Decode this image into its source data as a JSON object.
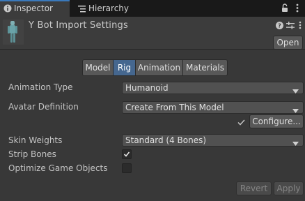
{
  "tabs": {
    "inspector": "Inspector",
    "hierarchy": "Hierarchy"
  },
  "header": {
    "title": "Y Bot Import Settings",
    "open_label": "Open"
  },
  "segments": [
    "Model",
    "Rig",
    "Animation",
    "Materials"
  ],
  "active_segment": "Rig",
  "fields": {
    "animation_type": {
      "label": "Animation Type",
      "value": "Humanoid"
    },
    "avatar_definition": {
      "label": "Avatar Definition",
      "value": "Create From This Model"
    },
    "configure_label": "Configure...",
    "skin_weights": {
      "label": "Skin Weights",
      "value": "Standard (4 Bones)"
    },
    "strip_bones": {
      "label": "Strip Bones",
      "checked": true
    },
    "optimize_game_objects": {
      "label": "Optimize Game Objects",
      "checked": false
    }
  },
  "footer": {
    "revert_label": "Revert",
    "apply_label": "Apply"
  },
  "colors": {
    "background": "#383838",
    "tab_accent": "#3a79bb",
    "active_segment": "#45678f"
  },
  "icons": [
    "info-icon",
    "hierarchy-icon",
    "lock-icon",
    "kebab-menu-icon",
    "help-icon",
    "presets-icon",
    "checkmark-icon",
    "dropdown-arrow-icon"
  ]
}
